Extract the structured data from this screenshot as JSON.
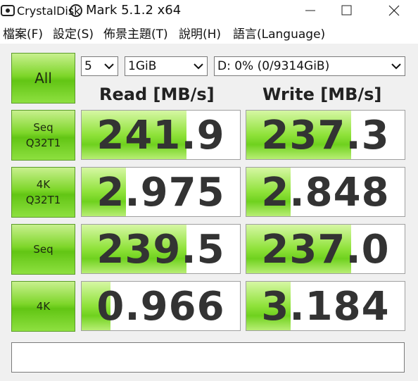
{
  "window": {
    "title_logo_text": "CrystalDisk",
    "title": "Mark 5.1.2 x64",
    "minimize_symbol": "—",
    "maximize_symbol": "☐",
    "close_symbol": "✕"
  },
  "menu": [
    {
      "label": "檔案(F)"
    },
    {
      "label": "設定(S)"
    },
    {
      "label": "佈景主題(T)"
    },
    {
      "label": "說明(H)"
    },
    {
      "label": "語言(Language)"
    }
  ],
  "controls": {
    "all_label": "All",
    "count_value": "5",
    "size_value": "1GiB",
    "drive_value": "D: 0% (0/9314GiB)"
  },
  "columns": {
    "read": "Read [MB/s]",
    "write": "Write [MB/s]"
  },
  "tests": [
    {
      "line1": "Seq",
      "line2": "Q32T1",
      "read": "241.9",
      "write": "237.3",
      "read_fill": 0.66,
      "write_fill": 0.66
    },
    {
      "line1": "4K",
      "line2": "Q32T1",
      "read": "2.975",
      "write": "2.848",
      "read_fill": 0.28,
      "write_fill": 0.28
    },
    {
      "line1": "Seq",
      "line2": "",
      "read": "239.5",
      "write": "237.0",
      "read_fill": 0.66,
      "write_fill": 0.66
    },
    {
      "line1": "4K",
      "line2": "",
      "read": "0.966",
      "write": "3.184",
      "read_fill": 0.18,
      "write_fill": 0.28
    }
  ],
  "status_text": "",
  "colors": {
    "accent_green": "#7ed62a",
    "value_text": "#333333"
  }
}
